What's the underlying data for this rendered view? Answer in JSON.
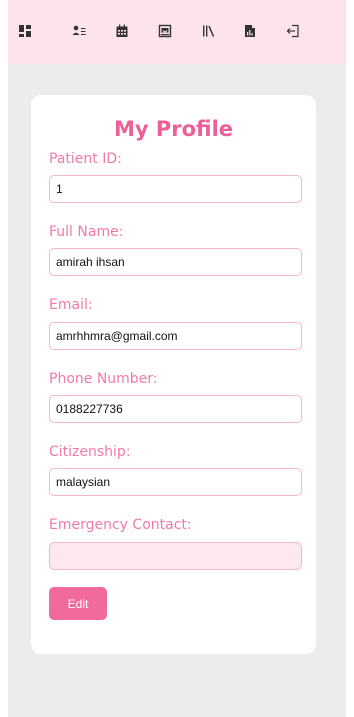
{
  "nav": {
    "icons": [
      "dashboard-icon",
      "user-list-icon",
      "calendar-icon",
      "inbox-icon",
      "library-icon",
      "report-file-icon",
      "logout-icon"
    ]
  },
  "profile": {
    "title": "My Profile",
    "fields": {
      "patient_id": {
        "label": "Patient ID:",
        "value": "1"
      },
      "full_name": {
        "label": "Full Name:",
        "value": "amirah ihsan"
      },
      "email": {
        "label": "Email:",
        "value": "amrhhmra@gmail.com"
      },
      "phone": {
        "label": "Phone Number:",
        "value": "0188227736"
      },
      "citizenship": {
        "label": "Citizenship:",
        "value": "malaysian"
      },
      "emergency_contact": {
        "label": "Emergency Contact:",
        "value": ""
      }
    },
    "edit_label": "Edit"
  },
  "colors": {
    "topbar": "#fde4ea",
    "accent": "#ec5f98",
    "label": "#f07aa8",
    "field_border": "#f5b7c9",
    "button": "#f06a9b",
    "background": "#ececec"
  }
}
